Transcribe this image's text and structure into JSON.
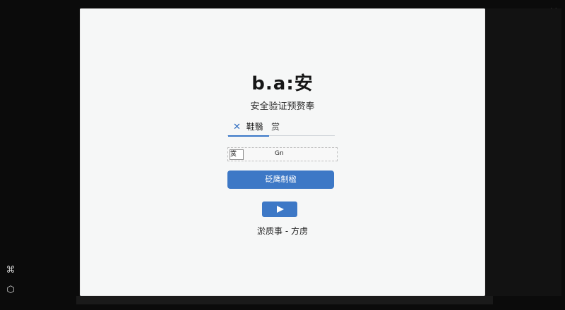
{
  "window": {
    "close_icon": "×"
  },
  "panel": {
    "title": "b.a:安",
    "subtitle": "安全验证预赘奉",
    "tabs": [
      {
        "label": "鞋翳",
        "icon": "✕"
      },
      {
        "label": "赏"
      }
    ],
    "form": {
      "left_value": "赏",
      "right_value": "Gn"
    },
    "confirm_button": "砭鹰制楹",
    "footer": "淤质事 - 方虏"
  },
  "left_toolbar": {
    "tool1_icon": "⌘",
    "tool2_icon": "⬡"
  },
  "colors": {
    "accent": "#3d78c6",
    "background": "#0b0b0b",
    "panel": "#f6f7f7"
  }
}
